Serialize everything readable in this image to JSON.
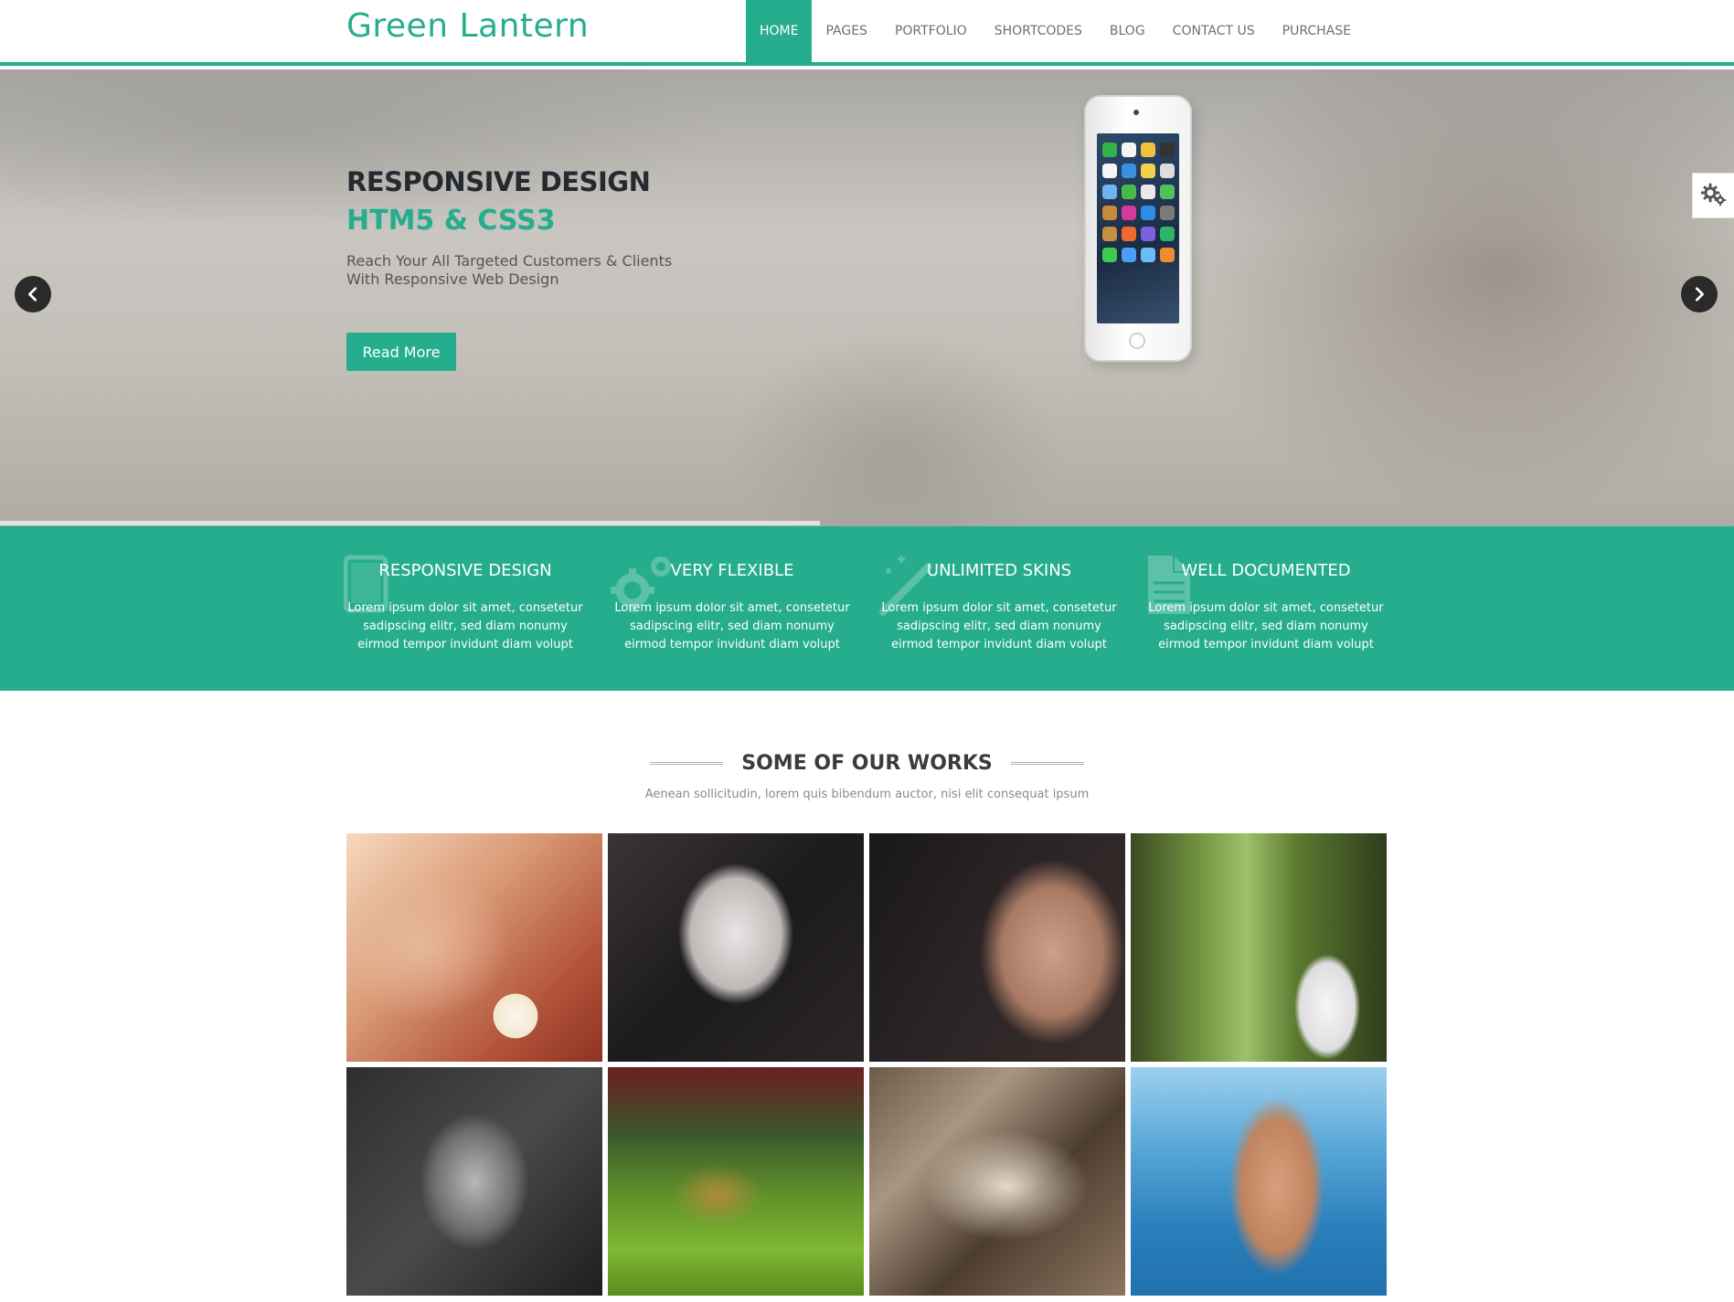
{
  "header": {
    "logo": "Green Lantern",
    "nav": [
      {
        "label": "HOME",
        "active": true
      },
      {
        "label": "PAGES"
      },
      {
        "label": "PORTFOLIO"
      },
      {
        "label": "SHORTCODES"
      },
      {
        "label": "BLOG"
      },
      {
        "label": "CONTACT US"
      },
      {
        "label": "PURCHASE"
      }
    ]
  },
  "hero": {
    "title": "RESPONSIVE DESIGN",
    "subtitle": "HTM5 & CSS3",
    "text_line1": "Reach Your All Targeted Customers & Clients",
    "text_line2": "With Responsive Web Design",
    "button": "Read More",
    "slide_progress": 0.473,
    "prev_icon": "chevron-left-icon",
    "next_icon": "chevron-right-icon"
  },
  "settings_icon": "gears-icon",
  "features": [
    {
      "icon": "tablet-icon",
      "title": "RESPONSIVE DESIGN",
      "text": "Lorem ipsum dolor sit amet, consetetur sadipscing elitr, sed diam nonumy eirmod tempor invidunt diam volupt"
    },
    {
      "icon": "gears-icon",
      "title": "VERY FLEXIBLE",
      "text": "Lorem ipsum dolor sit amet, consetetur sadipscing elitr, sed diam nonumy eirmod tempor invidunt diam volupt"
    },
    {
      "icon": "magic-wand-icon",
      "title": "UNLIMITED SKINS",
      "text": "Lorem ipsum dolor sit amet, consetetur sadipscing elitr, sed diam nonumy eirmod tempor invidunt diam volupt"
    },
    {
      "icon": "document-icon",
      "title": "WELL DOCUMENTED",
      "text": "Lorem ipsum dolor sit amet, consetetur sadipscing elitr, sed diam nonumy eirmod tempor invidunt diam volupt"
    }
  ],
  "works": {
    "title": "SOME OF OUR WORKS",
    "subtitle": "Aenean sollicitudin, lorem quis bibendum auctor, nisi elit consequat ipsum",
    "items": 8
  },
  "colors": {
    "accent": "#26ad8d",
    "dark_text": "#252a31"
  }
}
